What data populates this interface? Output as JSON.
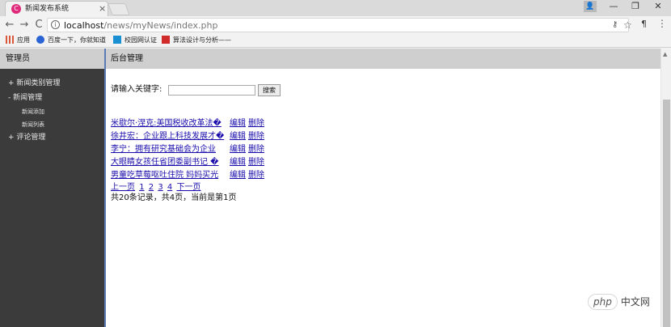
{
  "browser": {
    "tab_title": "新闻发布系统",
    "tab_close": "×",
    "favicon": "C",
    "url_host": "localhost",
    "url_path": "/news/myNews/index.php",
    "user_icon": "👤",
    "minimize": "—",
    "restore": "❐",
    "close": "✕",
    "back": "←",
    "forward": "→",
    "reload": "C",
    "info": "i",
    "key": "⚷",
    "star": "☆",
    "ext": "¶",
    "menu": "⋮",
    "bookmarks": [
      {
        "label": "应用",
        "color": "#d9573b"
      },
      {
        "label": "百度一下，你就知道",
        "color": "#2a63d4"
      },
      {
        "label": "校园网认证",
        "color": "#1a8fd1"
      },
      {
        "label": "算法设计与分析——",
        "color": "#d12a2a"
      }
    ]
  },
  "sidebar": {
    "header": "管理员",
    "items": [
      {
        "label": "+ 新闻类别管理"
      },
      {
        "label": "- 新闻管理"
      },
      {
        "label": "+ 评论管理"
      }
    ],
    "subitems": [
      {
        "label": "新闻添加"
      },
      {
        "label": "新闻列表"
      }
    ]
  },
  "main": {
    "header": "后台管理",
    "search": {
      "label": "请输入关键字:",
      "value": "",
      "button": "搜索"
    },
    "news": [
      {
        "title": "米歇尔·涅克:美国税收改革法�",
        "edit": "编辑",
        "delete": "删除"
      },
      {
        "title": "徐井宏：企业跟上科技发展才�",
        "edit": "编辑",
        "delete": "删除"
      },
      {
        "title": "李宁：拥有研究基础会为企业",
        "edit": "编辑",
        "delete": "删除"
      },
      {
        "title": "大眼睛女孩任省团委副书记 �",
        "edit": "编辑",
        "delete": "删除"
      },
      {
        "title": "男童吃草莓呕吐住院 妈妈买光",
        "edit": "编辑",
        "delete": "删除"
      }
    ],
    "pager": {
      "prev": "上一页",
      "pages": [
        "1",
        "2",
        "3",
        "4"
      ],
      "next": "下一页"
    },
    "summary": "共20条记录，共4页，当前是第1页"
  },
  "watermark": {
    "logo": "php",
    "text": "中文网"
  }
}
